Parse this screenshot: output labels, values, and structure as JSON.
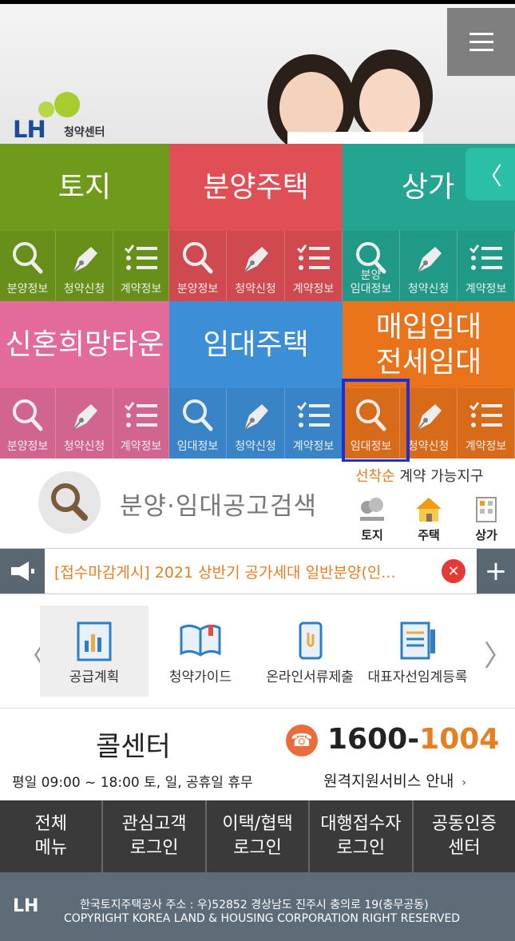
{
  "colors": {
    "green": "#6f9a1b",
    "red": "#e04f55",
    "teal": "#23a591",
    "pink": "#e26b9b",
    "blue": "#3c8ed6",
    "orange": "#e8731b",
    "highlight": "#1a2fd6"
  },
  "header": {
    "logo": "LH",
    "logo_sub": "청약센터",
    "menu_icon": "hamburger-icon"
  },
  "categories": [
    {
      "title": "토지",
      "items": [
        "분양정보",
        "청약신청",
        "계약정보"
      ]
    },
    {
      "title": "분양주택",
      "items": [
        "분양정보",
        "청약신청",
        "계약정보"
      ]
    },
    {
      "title": "상가",
      "items": [
        "분양\n임대정보",
        "청약신청",
        "계약정보"
      ]
    },
    {
      "title": "신혼희망타운",
      "items": [
        "분양정보",
        "청약신청",
        "계약정보"
      ]
    },
    {
      "title": "임대주택",
      "items": [
        "임대정보",
        "청약신청",
        "계약정보"
      ]
    },
    {
      "title": "매입임대\n전세임대",
      "items": [
        "임대정보",
        "청약신청",
        "계약정보"
      ]
    }
  ],
  "search": {
    "label": "분양·임대공고검색",
    "first_come_prefix": "선착순",
    "first_come_suffix": " 계약 가능지구",
    "mini": [
      "토지",
      "주택",
      "상가"
    ]
  },
  "notice": {
    "text": "[접수마감게시] 2021 상반기 공가세대 일반분양(인...",
    "close": "✕",
    "plus": "+"
  },
  "quick": {
    "items": [
      "공급계획",
      "청약가이드",
      "온라인서류제출",
      "대표자선임계등록"
    ],
    "prev": "〈",
    "next": "〉"
  },
  "call": {
    "title": "콜센터",
    "num_prefix": "1600-",
    "num_suffix": "1004",
    "hours": "평일 09:00 ~ 18:00 토, 일, 공휴일 휴무",
    "remote": "원격지원서비스 안내"
  },
  "bottom_menu": [
    "전체\n메뉴",
    "관심고객\n로그인",
    "이택/협택\n로그인",
    "대행접수자\n로그인",
    "공동인증\n센터"
  ],
  "footer": {
    "logo": "LH",
    "line1": "한국토지주택공사     주소 : 우)52852     경상남도 진주시 충의로 19(충무공동)",
    "line2": "COPYRIGHT KOREA LAND & HOUSING CORPORATION RIGHT RESERVED"
  }
}
